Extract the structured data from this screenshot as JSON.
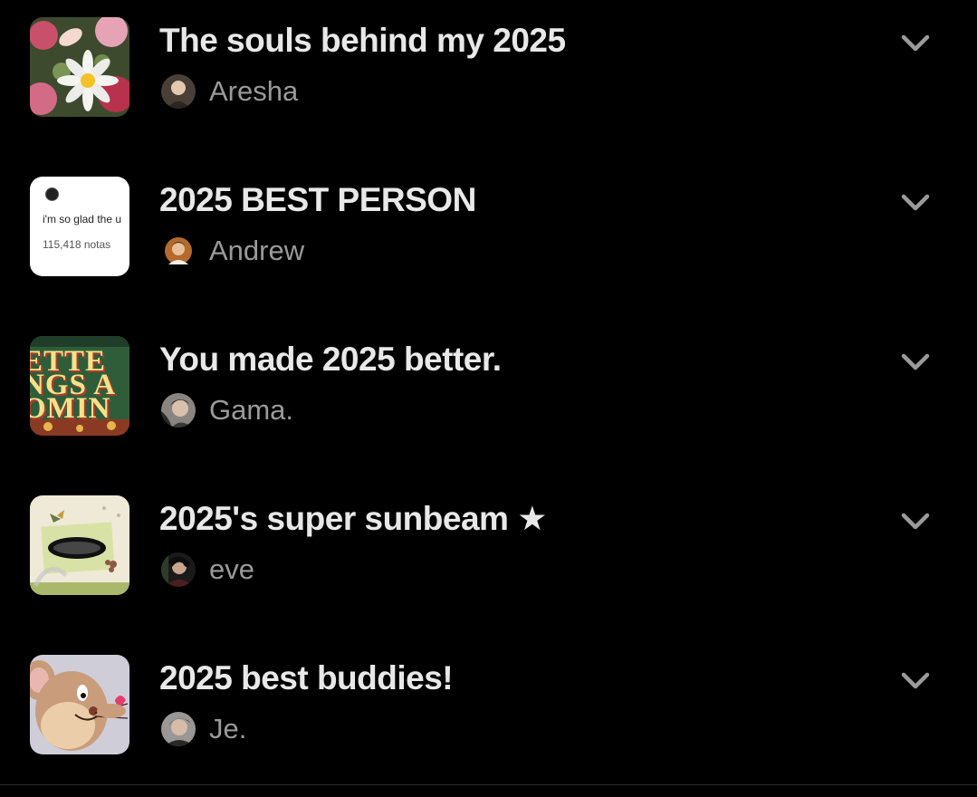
{
  "collections": [
    {
      "title": "The souls behind my 2025",
      "owner": "Aresha",
      "thumb_icon": "flower-bouquet-image",
      "avatar_icon": "user-avatar"
    },
    {
      "title": "2025 BEST PERSON",
      "owner": "Andrew",
      "thumb_icon": "text-post-image",
      "thumb_text": {
        "line1": "i'm so glad the u",
        "line2": "115,418 notas"
      },
      "avatar_icon": "user-avatar"
    },
    {
      "title": "You made 2025 better.",
      "owner": "Gama.",
      "thumb_icon": "retro-poster-image",
      "thumb_text": {
        "line1": "ETTE",
        "line2": "NGS A",
        "line3": "OMIN"
      },
      "avatar_icon": "user-avatar"
    },
    {
      "title": "2025's super sunbeam ★",
      "owner": "eve",
      "thumb_icon": "scrapbook-collage-image",
      "avatar_icon": "user-avatar"
    },
    {
      "title": "2025 best buddies!",
      "owner": "Je.",
      "thumb_icon": "cartoon-mouse-image",
      "avatar_icon": "user-avatar"
    }
  ],
  "expand_icon": "chevron-down-icon",
  "colors": {
    "background": "#000000",
    "title": "#e8e8e8",
    "owner": "#9a9a9a",
    "chevron": "#9a9a9a"
  }
}
